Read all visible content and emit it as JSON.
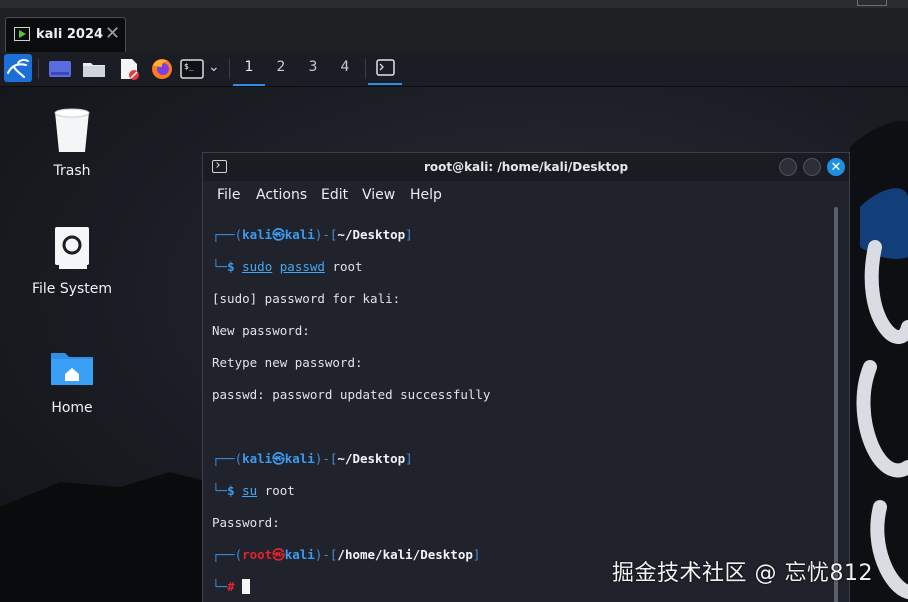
{
  "host": {
    "vm_tab_label": "kali 2024",
    "vm_tab_close": "✕"
  },
  "panel": {
    "workspaces": [
      "1",
      "2",
      "3",
      "4"
    ],
    "active_workspace": "1",
    "dropdown_glyph": "⌄",
    "colors": {
      "accent": "#2e8be8",
      "menu_bg": "#1d6fd8"
    }
  },
  "desktop": {
    "icons": [
      {
        "label": "Trash",
        "icon": "trash-icon"
      },
      {
        "label": "File System",
        "icon": "drive-icon"
      },
      {
        "label": "Home",
        "icon": "home-folder-icon"
      }
    ]
  },
  "terminal": {
    "title": "root@kali: /home/kali/Desktop",
    "close_glyph": "✕",
    "menu": [
      "File",
      "Actions",
      "Edit",
      "View",
      "Help"
    ],
    "lines": {
      "p1_top_pre": "┌──(",
      "p1_user": "kali",
      "p1_at": "㉿",
      "p1_host": "kali",
      "p1_mid": ")-[",
      "p1_path": "~/Desktop",
      "p1_end": "]",
      "p1_bottom_pre": "└─",
      "p1_dollar": "$ ",
      "p1_cmd_a": "sudo",
      "p1_cmd_b": " ",
      "p1_cmd_c": "passwd",
      "p1_cmd_d": " root",
      "out1": "[sudo] password for kali:",
      "out2": "New password:",
      "out3": "Retype new password:",
      "out4": "passwd: password updated successfully",
      "p2_top_pre": "┌──(",
      "p2_user": "kali",
      "p2_at": "㉿",
      "p2_host": "kali",
      "p2_mid": ")-[",
      "p2_path": "~/Desktop",
      "p2_end": "]",
      "p2_bottom_pre": "└─",
      "p2_dollar": "$ ",
      "p2_cmd_a": "su",
      "p2_cmd_b": " root",
      "out5": "Password:",
      "p3_top_pre": "┌──(",
      "p3_user": "root",
      "p3_at": "㉿",
      "p3_host": "kali",
      "p3_mid": ")-[",
      "p3_path": "/home/kali/Desktop",
      "p3_end": "]",
      "p3_bottom_pre": "└─",
      "p3_hash": "# "
    }
  },
  "watermark": "掘金技术社区 @ 忘忧812"
}
